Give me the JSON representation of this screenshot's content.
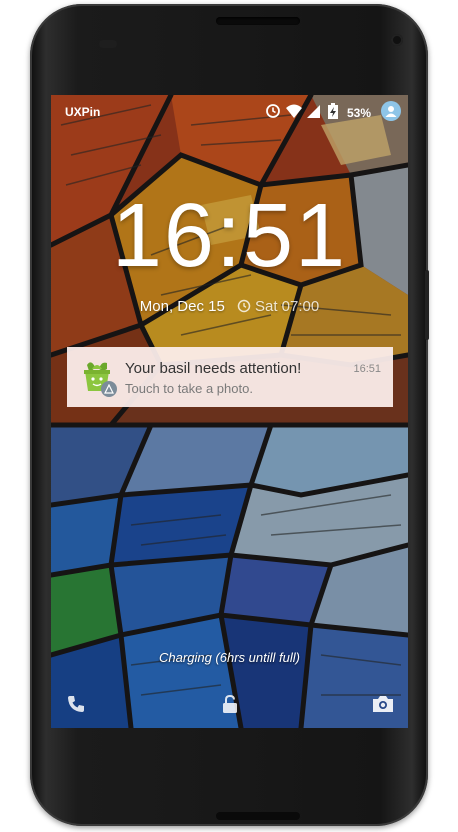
{
  "status_bar": {
    "carrier": "UXPin",
    "battery_percent": "53%",
    "icons": [
      "alarm-clock-icon",
      "wifi-icon",
      "cell-signal-icon",
      "battery-charging-icon",
      "user-avatar-icon"
    ]
  },
  "lockscreen": {
    "time": "16:51",
    "date": "Mon, Dec 15",
    "next_alarm": "Sat 07:00"
  },
  "notification": {
    "title": "Your basil needs attention!",
    "subtitle": "Touch to take a photo.",
    "time": "16:51",
    "app_icon": "plant-pot-icon",
    "badge_icon": "warning-triangle-icon"
  },
  "charging_text": "Charging (6hrs untill full)",
  "bottom_actions": [
    "phone-icon",
    "unlock-icon",
    "camera-icon"
  ],
  "colors": {
    "notification_bg": "#fceeec",
    "notification_accent": "#8cc63f",
    "avatar_bg": "#8ec5e8"
  }
}
